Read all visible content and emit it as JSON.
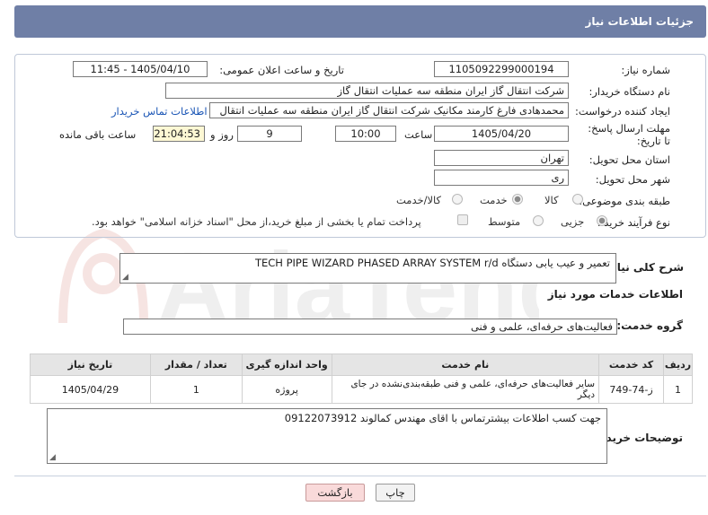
{
  "header": {
    "title": "جزئیات اطلاعات نیاز"
  },
  "form": {
    "need_number": {
      "label": "شماره نیاز:",
      "value": "1105092299000194"
    },
    "announce": {
      "label": "تاریخ و ساعت اعلان عمومی:",
      "value": "1405/04/10 - 11:45"
    },
    "buyer_org": {
      "label": "نام دستگاه خریدار:",
      "value": "شرکت انتقال گاز ایران منطقه سه عملیات انتقال گاز"
    },
    "creator": {
      "label": "ایجاد کننده درخواست:",
      "value": "محمدهادی فارغ کارمند مکانیک شرکت انتقال گاز ایران منطقه سه عملیات انتقال",
      "contact_link": "اطلاعات تماس خریدار"
    },
    "deadline": {
      "label": "مهلت ارسال پاسخ: تا تاریخ:",
      "date": "1405/04/20",
      "time_label": "ساعت",
      "time": "10:00",
      "days": "9",
      "days_label": "روز و",
      "remaining": "21:04:53",
      "remaining_label": "ساعت باقی مانده"
    },
    "province": {
      "label": "استان محل تحویل:",
      "value": "تهران"
    },
    "city": {
      "label": "شهر محل تحویل:",
      "value": "ری"
    },
    "category": {
      "label": "طبقه بندی موضوعی:",
      "options": [
        "کالا",
        "خدمت",
        "کالا/خدمت"
      ],
      "selected_index": 1
    },
    "process": {
      "label": "نوع فرآیند خرید :",
      "options": [
        "جزیی",
        "متوسط"
      ],
      "selected_index": 0,
      "payment_note": "پرداخت تمام یا بخشی از مبلغ خرید،از محل \"اسناد خزانه اسلامی\" خواهد بود."
    }
  },
  "description": {
    "label": "شرح کلی نیاز:",
    "value": "تعمیر و عیب یابی دستگاه  TECH PIPE WIZARD  PHASED ARRAY SYSTEM  r/d"
  },
  "services": {
    "section_title": "اطلاعات خدمات مورد نیاز",
    "group_label": "گروه خدمت:",
    "group_value": "فعالیت‌های حرفه‌ای، علمی و فنی",
    "columns": [
      "ردیف",
      "کد خدمت",
      "نام خدمت",
      "واحد اندازه گیری",
      "تعداد / مقدار",
      "تاریخ نیاز"
    ],
    "rows": [
      [
        "1",
        "ز-74-749",
        "سایر فعالیت‌های حرفه‌ای، علمی و فنی طبقه‌بندی‌نشده در جای دیگر",
        "پروژه",
        "1",
        "1405/04/29"
      ]
    ]
  },
  "buyer_notes": {
    "label": "توضیحات خریدار:",
    "value": "جهت کسب اطلاعات بیشترتماس با اقای مهندس کمالوند  09122073912"
  },
  "buttons": {
    "print": "چاپ",
    "back": "بازگشت"
  },
  "watermark": {
    "text": "AriaTender.net"
  },
  "colors": {
    "header": "#6f7fa6",
    "remaining_bg": "#fdf8d4",
    "link": "#1a55b5",
    "back_button": "#f9dada"
  }
}
